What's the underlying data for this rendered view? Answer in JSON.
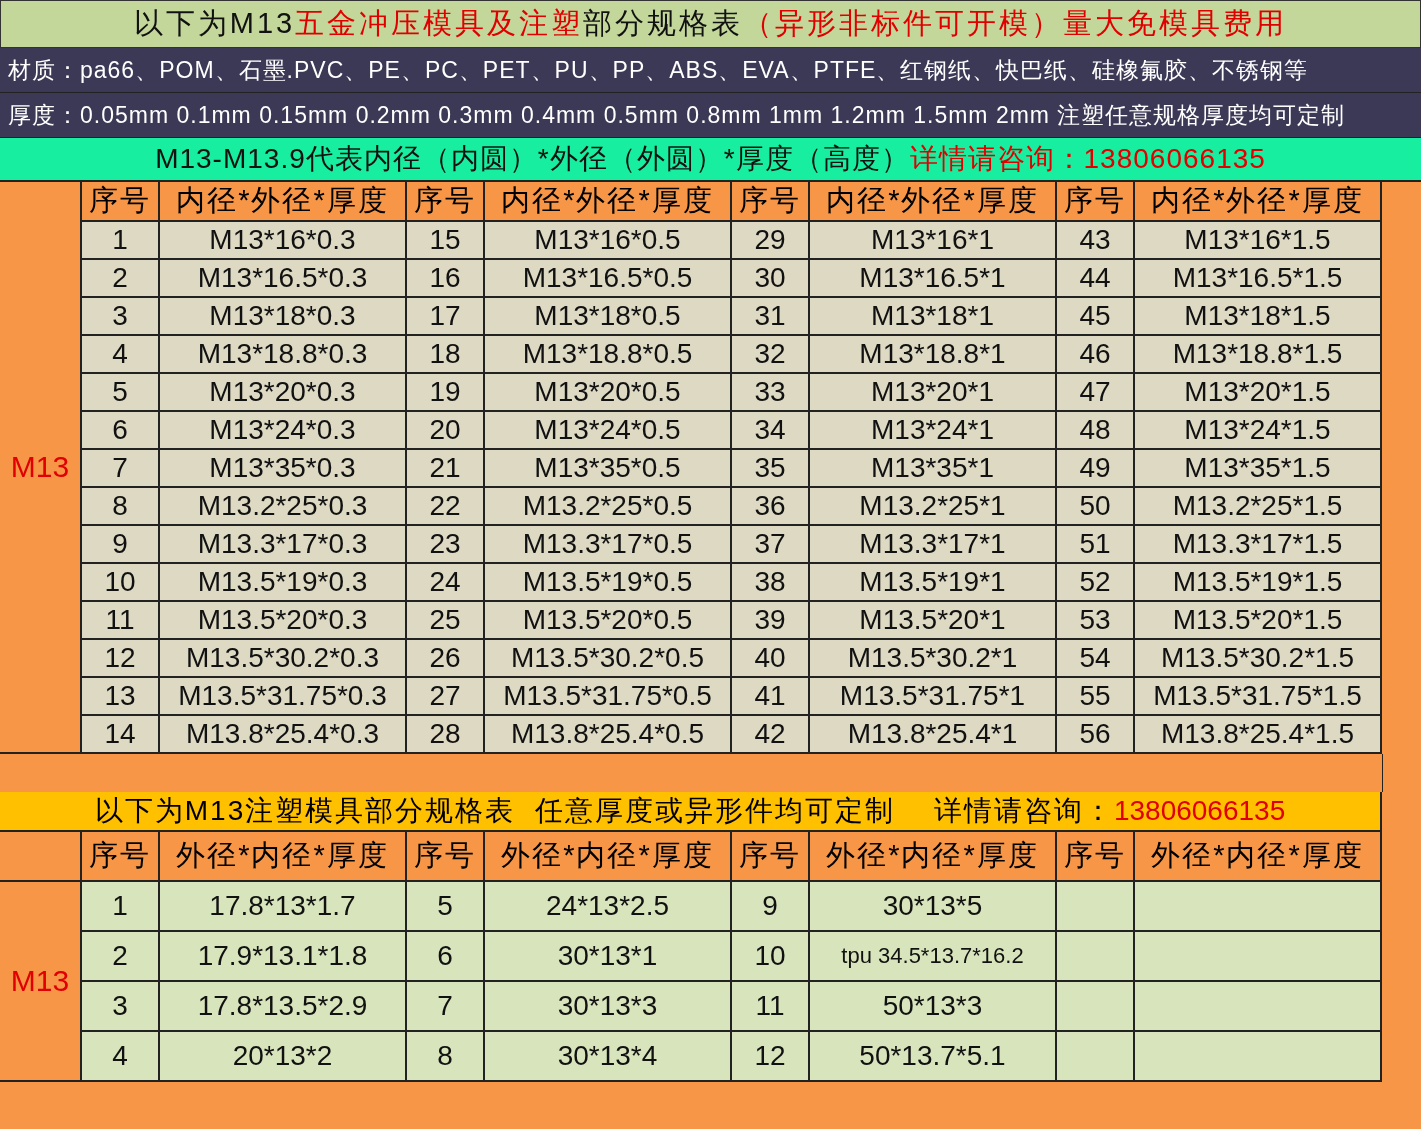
{
  "title": [
    {
      "text": "以下为M13",
      "highlight": false
    },
    {
      "text": "五金冲压模具及注塑",
      "highlight": true
    },
    {
      "text": "部分规格表",
      "highlight": false
    },
    {
      "text": "（异形非标件可开模）量大免模具费用",
      "highlight": true
    }
  ],
  "materials": "材质：pa66、POM、石墨.PVC、PE、PC、PET、PU、PP、ABS、EVA、PTFE、红钢纸、快巴纸、硅橡氟胶、不锈钢等",
  "thickness": "厚度：0.05mm 0.1mm 0.15mm 0.2mm 0.3mm 0.4mm 0.5mm 0.8mm 1mm 1.2mm 1.5mm 2mm 注塑任意规格厚度均可定制",
  "legend": [
    {
      "text": "M13-M13.9代表内径（内圆）*外径（外圆）*厚度（高度）",
      "highlight": false
    },
    {
      "text": "详情请咨询：13806066135",
      "highlight": true
    }
  ],
  "table_1": {
    "group_label": "M13",
    "columns": [
      "序号",
      "内径*外径*厚度",
      "序号",
      "内径*外径*厚度",
      "序号",
      "内径*外径*厚度",
      "序号",
      "内径*外径*厚度"
    ],
    "rows": [
      [
        "1",
        "M13*16*0.3",
        "15",
        "M13*16*0.5",
        "29",
        "M13*16*1",
        "43",
        "M13*16*1.5"
      ],
      [
        "2",
        "M13*16.5*0.3",
        "16",
        "M13*16.5*0.5",
        "30",
        "M13*16.5*1",
        "44",
        "M13*16.5*1.5"
      ],
      [
        "3",
        "M13*18*0.3",
        "17",
        "M13*18*0.5",
        "31",
        "M13*18*1",
        "45",
        "M13*18*1.5"
      ],
      [
        "4",
        "M13*18.8*0.3",
        "18",
        "M13*18.8*0.5",
        "32",
        "M13*18.8*1",
        "46",
        "M13*18.8*1.5"
      ],
      [
        "5",
        "M13*20*0.3",
        "19",
        "M13*20*0.5",
        "33",
        "M13*20*1",
        "47",
        "M13*20*1.5"
      ],
      [
        "6",
        "M13*24*0.3",
        "20",
        "M13*24*0.5",
        "34",
        "M13*24*1",
        "48",
        "M13*24*1.5"
      ],
      [
        "7",
        "M13*35*0.3",
        "21",
        "M13*35*0.5",
        "35",
        "M13*35*1",
        "49",
        "M13*35*1.5"
      ],
      [
        "8",
        "M13.2*25*0.3",
        "22",
        "M13.2*25*0.5",
        "36",
        "M13.2*25*1",
        "50",
        "M13.2*25*1.5"
      ],
      [
        "9",
        "M13.3*17*0.3",
        "23",
        "M13.3*17*0.5",
        "37",
        "M13.3*17*1",
        "51",
        "M13.3*17*1.5"
      ],
      [
        "10",
        "M13.5*19*0.3",
        "24",
        "M13.5*19*0.5",
        "38",
        "M13.5*19*1",
        "52",
        "M13.5*19*1.5"
      ],
      [
        "11",
        "M13.5*20*0.3",
        "25",
        "M13.5*20*0.5",
        "39",
        "M13.5*20*1",
        "53",
        "M13.5*20*1.5"
      ],
      [
        "12",
        "M13.5*30.2*0.3",
        "26",
        "M13.5*30.2*0.5",
        "40",
        "M13.5*30.2*1",
        "54",
        "M13.5*30.2*1.5"
      ],
      [
        "13",
        "M13.5*31.75*0.3",
        "27",
        "M13.5*31.75*0.5",
        "41",
        "M13.5*31.75*1",
        "55",
        "M13.5*31.75*1.5"
      ],
      [
        "14",
        "M13.8*25.4*0.3",
        "28",
        "M13.8*25.4*0.5",
        "42",
        "M13.8*25.4*1",
        "56",
        "M13.8*25.4*1.5"
      ]
    ]
  },
  "table_2": {
    "title": [
      {
        "text": "以下为M13注塑模具部分规格表  任意厚度或异形件均可定制    详情请咨询：",
        "highlight": false
      },
      {
        "text": "13806066135",
        "highlight": true
      }
    ],
    "group_label": "M13",
    "columns": [
      "序号",
      "外径*内径*厚度",
      "序号",
      "外径*内径*厚度",
      "序号",
      "外径*内径*厚度",
      "序号",
      "外径*内径*厚度"
    ],
    "rows": [
      [
        "1",
        "17.8*13*1.7",
        "5",
        "24*13*2.5",
        "9",
        "30*13*5"
      ],
      [
        "2",
        "17.9*13.1*1.8",
        "6",
        "30*13*1",
        "10",
        "tpu 34.5*13.7*16.2"
      ],
      [
        "3",
        "17.8*13.5*2.9",
        "7",
        "30*13*3",
        "11",
        "50*13*3"
      ],
      [
        "4",
        "20*13*2",
        "8",
        "30*13*4",
        "12",
        "50*13.7*5.1"
      ]
    ]
  }
}
